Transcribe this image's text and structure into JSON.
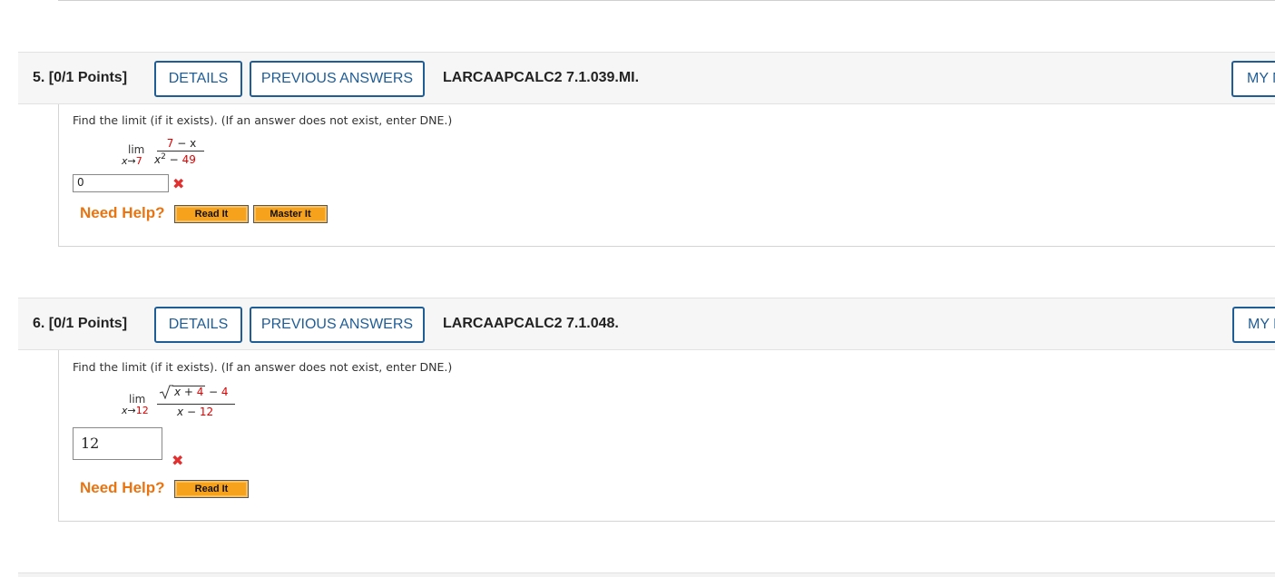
{
  "q5": {
    "number": "5.",
    "points": "[0/1 Points]",
    "details_label": "DETAILS",
    "previous_answers_label": "PREVIOUS ANSWERS",
    "code": "LARCAAPCALC2 7.1.039.MI.",
    "my_label": "MY NOTES",
    "prompt": "Find the limit (if it exists). (If an answer does not exist, enter DNE.)",
    "lim_word": "lim",
    "lim_sub_var": "x",
    "lim_sub_arrow": "→",
    "lim_sub_value": "7",
    "numerator_value": "7",
    "numerator_rest": "− x",
    "denominator_var": "x",
    "denominator_exp": "2",
    "denominator_minus": "−",
    "denominator_value": "49",
    "answer_value": "0",
    "result_icon": "x-mark-icon",
    "need_help_label": "Need Help?",
    "read_it_label": "Read It",
    "master_it_label": "Master It"
  },
  "q6": {
    "number": "6.",
    "points": "[0/1 Points]",
    "details_label": "DETAILS",
    "previous_answers_label": "PREVIOUS ANSWERS",
    "code": "LARCAAPCALC2 7.1.048.",
    "my_label": "MY NOTES",
    "prompt": "Find the limit (if it exists). (If an answer does not exist, enter DNE.)",
    "lim_word": "lim",
    "lim_sub_var": "x",
    "lim_sub_arrow": "→",
    "lim_sub_value": "12",
    "sqrt_inner": "x + 4",
    "sqrt_minus": "−",
    "numerator_value": "4",
    "denominator_var": "x",
    "denominator_minus": "−",
    "denominator_value": "12",
    "answer_value": "12",
    "result_icon": "x-mark-icon",
    "need_help_label": "Need Help?",
    "read_it_label": "Read It"
  },
  "colors": {
    "link_blue": "#1f5d96",
    "help_orange": "#e87511",
    "incorrect_red": "#e03030",
    "button_orange": "#f7a21c"
  }
}
